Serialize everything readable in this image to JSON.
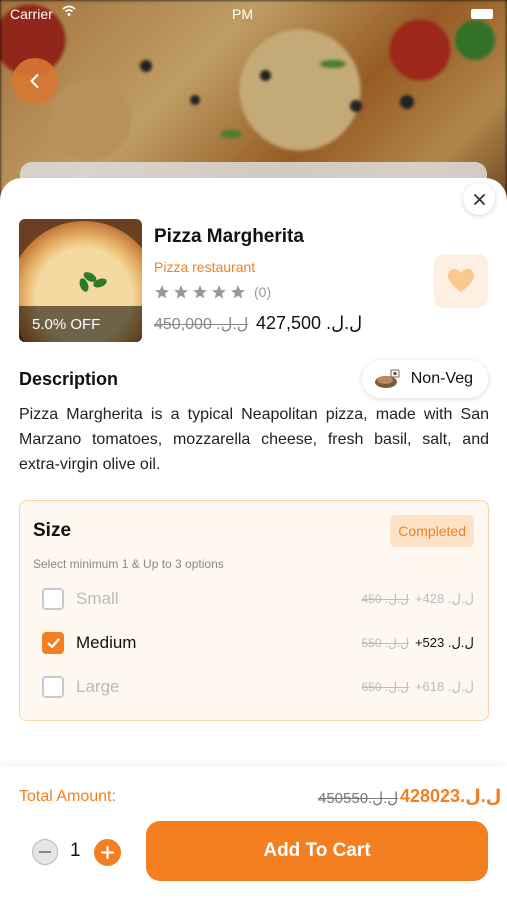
{
  "status_bar": {
    "carrier": "Carrier",
    "time": "PM"
  },
  "product": {
    "name": "Pizza Margherita",
    "restaurant": "Pizza restaurant",
    "rating_count": "(0)",
    "rating_stars": 0,
    "discount_badge": "5.0% OFF",
    "price_old": "450,000 .ل.ل",
    "price_new": "427,500 .ل.ل",
    "diet_label": "Non-Veg"
  },
  "description": {
    "title": "Description",
    "text": "Pizza Margherita is a typical Neapolitan pizza, made with San Marzano tomatoes, mozzarella cheese, fresh basil, salt, and extra-virgin olive oil."
  },
  "size_group": {
    "title": "Size",
    "status": "Completed",
    "hint": "Select minimum 1 & Up to 3 options",
    "options": [
      {
        "label": "Small",
        "price_old": "450 .ل.ل",
        "price_new": "+428 .ل.ل",
        "checked": false
      },
      {
        "label": "Medium",
        "price_old": "550 .ل.ل",
        "price_new": "+523 .ل.ل",
        "checked": true
      },
      {
        "label": "Large",
        "price_old": "650 .ل.ل",
        "price_new": "+618 .ل.ل",
        "checked": false
      }
    ]
  },
  "footer": {
    "total_label": "Total Amount:",
    "total_old": "450550.ل.ل",
    "total_new": "428023.ل.ل",
    "quantity": "1",
    "add_to_cart": "Add To Cart"
  },
  "colors": {
    "accent": "#f47f20",
    "accent_light": "#fde2c8",
    "panel_bg": "#fff8f1"
  }
}
